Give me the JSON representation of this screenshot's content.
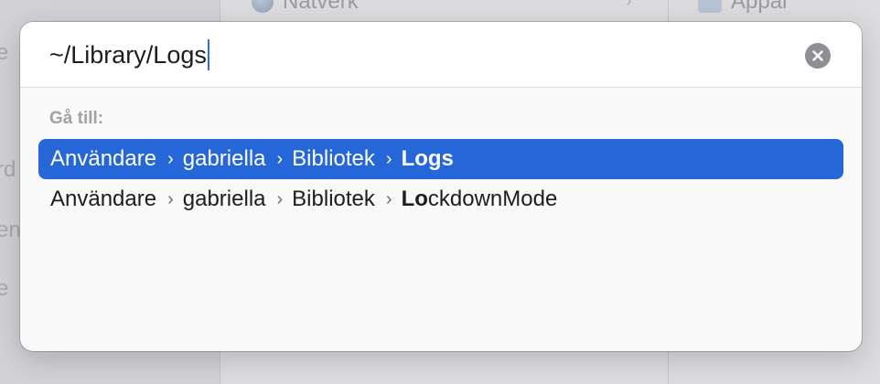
{
  "background": {
    "sidebar_fragments": [
      "e",
      "rd",
      "en",
      "e"
    ],
    "network_label": "Nätverk",
    "apps_label": "Appar"
  },
  "dialog": {
    "path_value": "~/Library/Logs",
    "goto_label": "Gå till:",
    "results": [
      {
        "segments": [
          "Användare",
          "gabriella",
          "Bibliotek"
        ],
        "last_bold": "Logs",
        "last_rest": "",
        "selected": true
      },
      {
        "segments": [
          "Användare",
          "gabriella",
          "Bibliotek"
        ],
        "last_bold": "Lo",
        "last_rest": "ckdownMode",
        "selected": false
      }
    ]
  },
  "colors": {
    "accent": "#2566d9",
    "caret": "#2a6ef5"
  },
  "icons": {
    "clear": "close-circle-icon",
    "separator": "chevron-right-icon",
    "network": "globe-icon",
    "apps": "applications-folder-icon"
  }
}
